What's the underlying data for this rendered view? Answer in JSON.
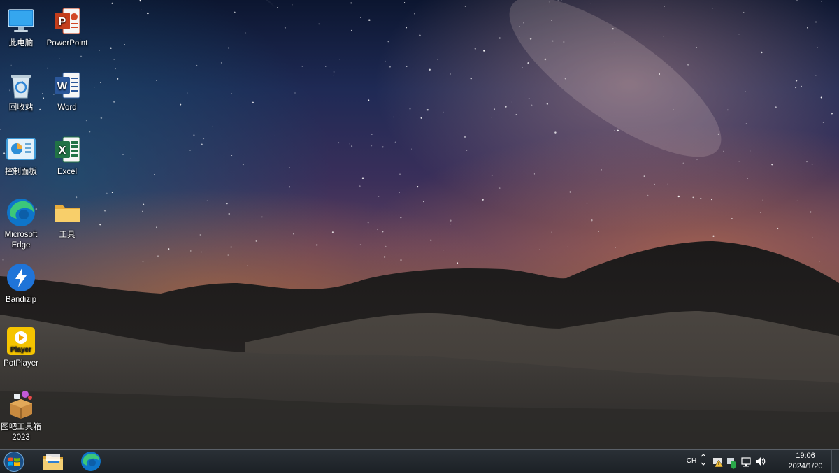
{
  "desktop": {
    "wallpaper": "starry-night-hills",
    "icons": [
      {
        "label": "此电脑",
        "icon": "computer-icon"
      },
      {
        "label": "PowerPoint",
        "icon": "powerpoint-icon"
      },
      {
        "label": "回收站",
        "icon": "recycle-bin-icon"
      },
      {
        "label": "Word",
        "icon": "word-icon"
      },
      {
        "label": "控制面板",
        "icon": "control-panel-icon"
      },
      {
        "label": "Excel",
        "icon": "excel-icon"
      },
      {
        "label": "Microsoft Edge",
        "icon": "edge-icon"
      },
      {
        "label": "工具",
        "icon": "folder-icon"
      },
      {
        "label": "Bandizip",
        "icon": "bandizip-icon"
      },
      {
        "label": "PotPlayer",
        "icon": "potplayer-icon",
        "badge": "Player"
      },
      {
        "label": "图吧工具箱 2023",
        "icon": "toolbox-icon"
      }
    ]
  },
  "taskbar": {
    "pinned": [
      {
        "name": "file-explorer-icon"
      },
      {
        "name": "edge-icon"
      }
    ],
    "tray": {
      "input_method": "CH",
      "clock_time": "19:06",
      "clock_date": "2024/1/20"
    }
  },
  "colors": {
    "taskbar": "#22282e",
    "powerpoint": "#c43e1c",
    "word": "#2b579a",
    "excel": "#217346",
    "folder": "#f4c45a",
    "bandizip": "#1f74d8",
    "potplayer": "#f5c400"
  }
}
